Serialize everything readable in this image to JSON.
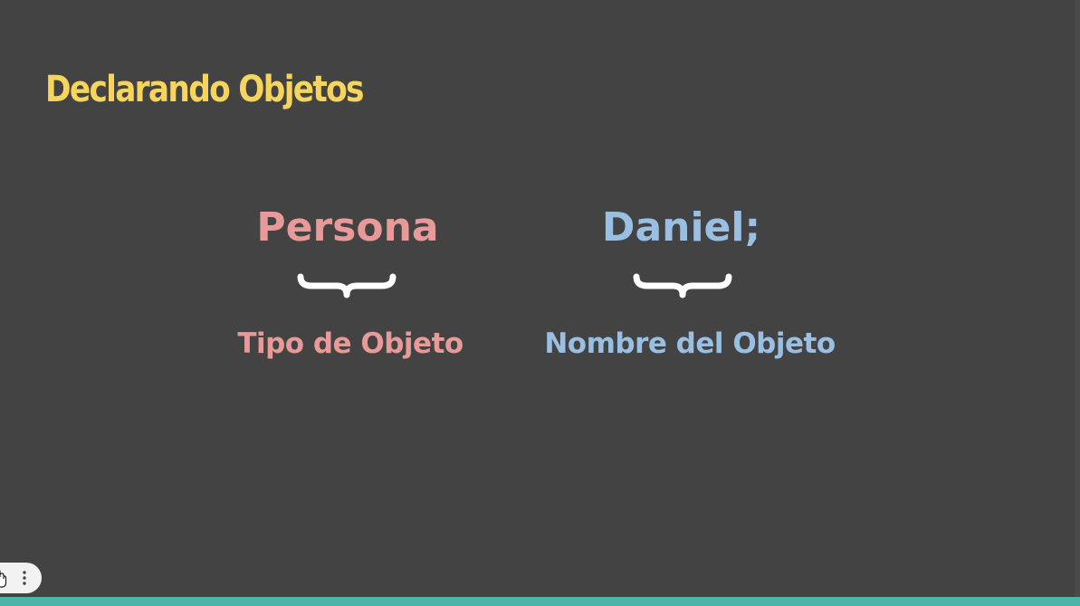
{
  "slide": {
    "title": "Declarando Objetos",
    "type_word": "Persona",
    "name_word": "Daniel;",
    "type_caption": "Tipo de Objeto",
    "name_caption": "Nombre del Objeto"
  },
  "colors": {
    "background": "#434343",
    "title": "#f7d55c",
    "type": "#e89a98",
    "name": "#99bfe2",
    "brace": "#ffffff",
    "progress": "#4bb6a7"
  },
  "player": {
    "progress_fraction": 1.0,
    "icons": [
      "pointer-cursor-icon",
      "more-options-icon"
    ]
  }
}
